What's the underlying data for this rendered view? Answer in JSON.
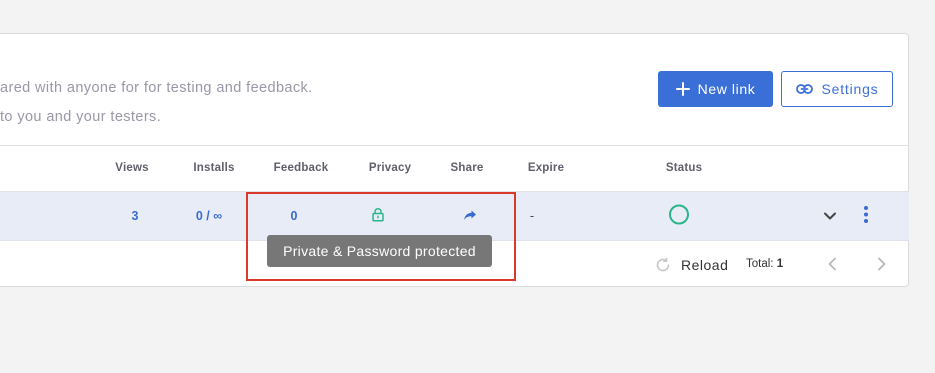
{
  "description": {
    "line1": "ared with anyone for for testing and feedback.",
    "line2": "to you and your testers."
  },
  "buttons": {
    "new_link": "New link",
    "settings": "Settings"
  },
  "table": {
    "columns": [
      "Views",
      "Installs",
      "Feedback",
      "Privacy",
      "Share",
      "Expire",
      "Status"
    ],
    "row": {
      "views": "3",
      "installs": "0 / ∞",
      "feedback": "0",
      "privacy_icon": "lock-icon",
      "share_icon": "share-arrow-icon",
      "expire": "-",
      "status_icon": "status-circle-icon"
    }
  },
  "footer": {
    "reload": "Reload",
    "total_label": "Total:",
    "total_value": "1"
  },
  "tooltip": {
    "text": "Private & Password protected"
  },
  "colors": {
    "accent": "#3b6fd8",
    "status_green": "#2bb58a",
    "highlight_red": "#d93a2b",
    "row_bg": "#e8ecf7"
  }
}
